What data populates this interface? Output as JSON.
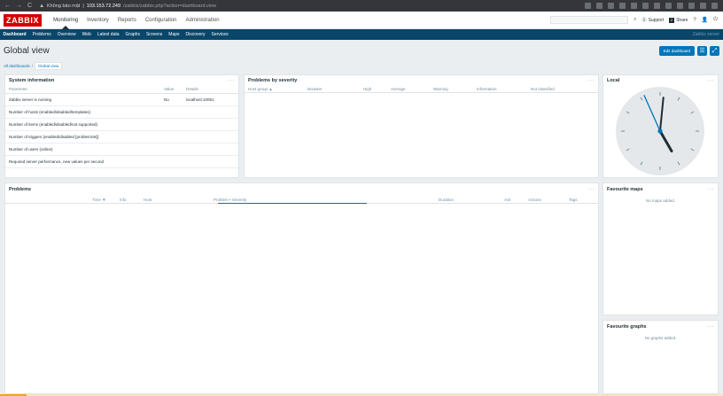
{
  "browser": {
    "security_label": "Không bảo mật",
    "host": "103.153.72.249",
    "path": "/zabbix/zabbix.php?action=dashboard.view",
    "icons": [
      "back-icon",
      "forward-icon",
      "reload-icon",
      "warning-icon",
      "key-icon",
      "extension-icon",
      "menu-icon"
    ]
  },
  "header": {
    "logo": "ZABBIX",
    "nav": [
      "Monitoring",
      "Inventory",
      "Reports",
      "Configuration",
      "Administration"
    ],
    "support_label": "Support",
    "share_label": "Share",
    "help_label": "?"
  },
  "subnav": {
    "items": [
      "Dashboard",
      "Problems",
      "Overview",
      "Web",
      "Latest data",
      "Graphs",
      "Screens",
      "Maps",
      "Discovery",
      "Services"
    ],
    "server_name": "Zabbix server"
  },
  "page": {
    "title": "Global view",
    "edit_button": "Edit dashboard",
    "breadcrumb_root": "All dashboards",
    "breadcrumb_sep": "/",
    "breadcrumb_current": "Global view"
  },
  "system_info": {
    "title": "System information",
    "columns": [
      "Parameter",
      "Value",
      "Details"
    ],
    "rows": [
      {
        "param": "Zabbix server is running",
        "value": "No",
        "details": "localhost:10051"
      },
      {
        "param": "Number of hosts (enabled/disabled/templates)",
        "value": "",
        "details": ""
      },
      {
        "param": "Number of items (enabled/disabled/not supported)",
        "value": "",
        "details": ""
      },
      {
        "param": "Number of triggers (enabled/disabled [problem/ok])",
        "value": "",
        "details": ""
      },
      {
        "param": "Number of users (online)",
        "value": "",
        "details": ""
      },
      {
        "param": "Required server performance, new values per second",
        "value": "",
        "details": ""
      }
    ]
  },
  "severity": {
    "title": "Problems by severity",
    "columns": [
      "Host group ▲",
      "Disaster",
      "High",
      "Average",
      "Warning",
      "Information",
      "Not classified"
    ]
  },
  "clock": {
    "title": "Local",
    "hour": 5,
    "minute": 0,
    "second": 56
  },
  "problems": {
    "title": "Problems",
    "columns": [
      "Time ▼",
      "Info",
      "Host",
      "Problem • Severity",
      "Duration",
      "Ack",
      "Actions",
      "Tags"
    ]
  },
  "fav_maps": {
    "title": "Favourite maps",
    "empty": "No maps added."
  },
  "fav_graphs": {
    "title": "Favourite graphs",
    "empty": "No graphs added."
  },
  "colors": {
    "brand": "#d40000",
    "subnav": "#0a466a",
    "accent": "#0275b8",
    "problem": "#e33734"
  }
}
